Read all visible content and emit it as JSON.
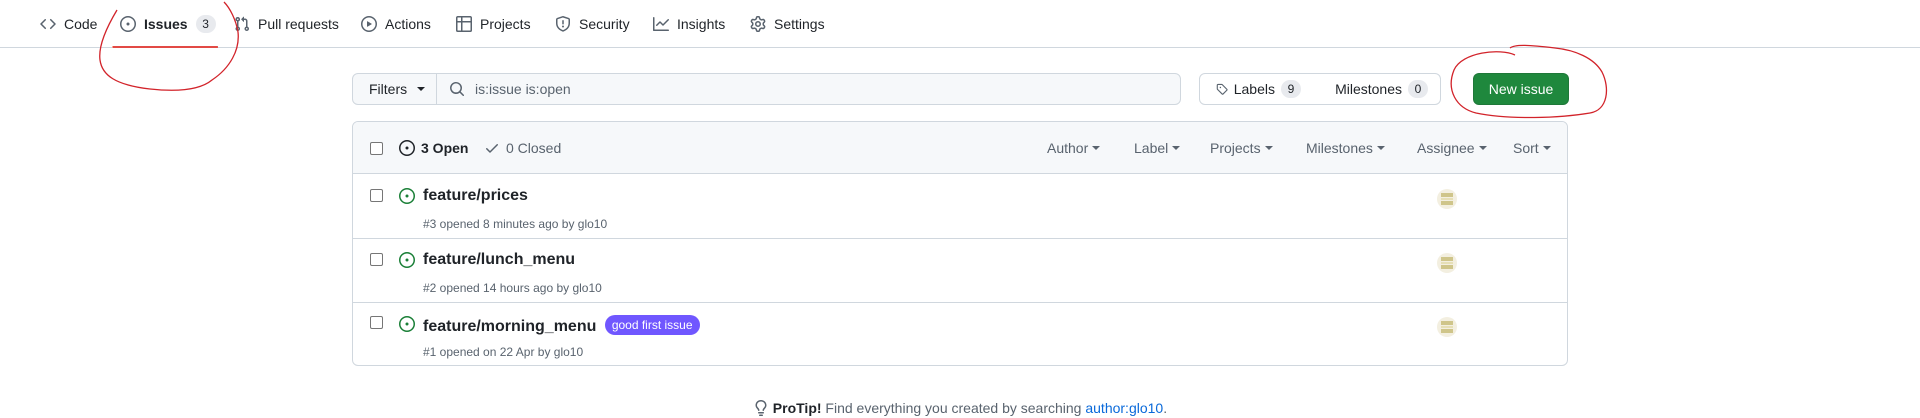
{
  "nav": {
    "items": [
      {
        "label": "Code",
        "icon": "code-icon"
      },
      {
        "label": "Issues",
        "icon": "issue-opened-icon",
        "count": "3",
        "selected": true
      },
      {
        "label": "Pull requests",
        "icon": "git-pull-request-icon"
      },
      {
        "label": "Actions",
        "icon": "play-icon"
      },
      {
        "label": "Projects",
        "icon": "table-icon"
      },
      {
        "label": "Security",
        "icon": "shield-icon"
      },
      {
        "label": "Insights",
        "icon": "graph-icon"
      },
      {
        "label": "Settings",
        "icon": "gear-icon"
      }
    ]
  },
  "subnav": {
    "filters_label": "Filters",
    "search_value": "is:issue is:open",
    "labels_label": "Labels",
    "labels_count": "9",
    "milestones_label": "Milestones",
    "milestones_count": "0",
    "new_issue_label": "New issue"
  },
  "list_header": {
    "open_label": "3 Open",
    "closed_label": "0 Closed",
    "filters": [
      "Author",
      "Label",
      "Projects",
      "Milestones",
      "Assignee",
      "Sort"
    ]
  },
  "issues": [
    {
      "title": "feature/prices",
      "meta": "#3 opened 8 minutes ago by glo10",
      "label": ""
    },
    {
      "title": "feature/lunch_menu",
      "meta": "#2 opened 14 hours ago by glo10",
      "label": ""
    },
    {
      "title": "feature/morning_menu",
      "meta": "#1 opened on 22 Apr by glo10",
      "label": "good first issue"
    }
  ],
  "protip": {
    "lead": "ProTip!",
    "text": " Find everything you created by searching ",
    "link": "author:glo10",
    "trail": "."
  },
  "colors": {
    "accent_green": "#1f883d",
    "open_icon": "#1a7f37",
    "label_purple": "#7057ff",
    "link_blue": "#0969da",
    "annotation_red": "#d2232a"
  }
}
